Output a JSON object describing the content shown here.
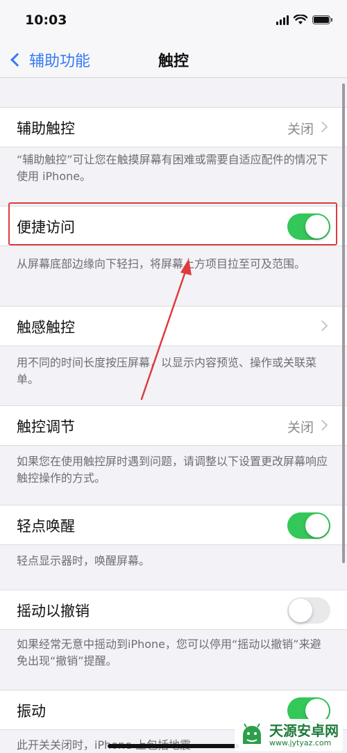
{
  "status_bar": {
    "time": "10:03"
  },
  "nav": {
    "back_label": "辅助功能",
    "title": "触控"
  },
  "sections": {
    "assistive_touch": {
      "label": "辅助触控",
      "value": "关闭",
      "footnote": "“辅助触控”可让您在触摸屏幕有困难或需要自适应配件的情况下使用 iPhone。"
    },
    "reachability": {
      "label": "便捷访问",
      "toggle": true,
      "footnote": "从屏幕底部边缘向下轻扫，将屏幕上方项目拉至可及范围。"
    },
    "haptic_touch": {
      "label": "触感触控",
      "footnote": "用不同的时间长度按压屏幕，以显示内容预览、操作或关联菜单。"
    },
    "touch_accommodations": {
      "label": "触控调节",
      "value": "关闭",
      "footnote": "如果您在使用触控屏时遇到问题，请调整以下设置更改屏幕响应触控操作的方式。"
    },
    "tap_to_wake": {
      "label": "轻点唤醒",
      "toggle": true,
      "footnote": "轻点显示器时，唤醒屏幕。"
    },
    "shake_to_undo": {
      "label": "摇动以撤销",
      "toggle": false,
      "footnote": "如果经常无意中摇动到iPhone，您可以停用“摇动以撤销”来避免出现“撤销”提醒。"
    },
    "vibration": {
      "label": "振动",
      "toggle": true,
      "footnote": "此开关关闭时，iPhone 上包括地震"
    }
  },
  "annotation": {
    "color": "#e03a3a"
  },
  "watermark": {
    "name": "天源安卓网",
    "url": "www.jytyaz.com"
  },
  "colors": {
    "accent": "#3478f6",
    "toggle_on": "#34c759",
    "toggle_off": "#e9e9eb"
  }
}
